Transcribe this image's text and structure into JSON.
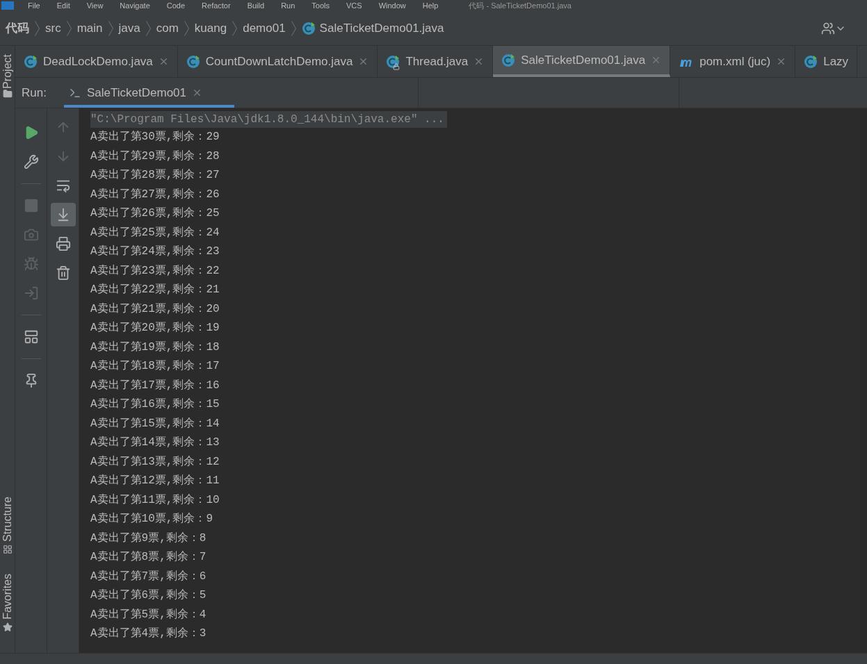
{
  "menu": [
    "File",
    "Edit",
    "View",
    "Navigate",
    "Code",
    "Refactor",
    "Build",
    "Run",
    "Tools",
    "VCS",
    "Window",
    "Help"
  ],
  "window_title": "代码 - SaleTicketDemo01.java",
  "breadcrumb": [
    {
      "label": "代码",
      "kind": "project"
    },
    {
      "label": "src",
      "kind": "folder"
    },
    {
      "label": "main",
      "kind": "folder"
    },
    {
      "label": "java",
      "kind": "folder"
    },
    {
      "label": "com",
      "kind": "folder"
    },
    {
      "label": "kuang",
      "kind": "folder"
    },
    {
      "label": "demo01",
      "kind": "folder"
    },
    {
      "label": "SaleTicketDemo01.java",
      "kind": "class"
    }
  ],
  "editor_tabs": [
    {
      "label": "DeadLockDemo.java",
      "kind": "class",
      "selected": false,
      "locked": false
    },
    {
      "label": "CountDownLatchDemo.java",
      "kind": "class",
      "selected": false,
      "locked": false
    },
    {
      "label": "Thread.java",
      "kind": "class",
      "selected": false,
      "locked": true
    },
    {
      "label": "SaleTicketDemo01.java",
      "kind": "class",
      "selected": true,
      "locked": false
    },
    {
      "label": "pom.xml (juc)",
      "kind": "maven",
      "selected": false,
      "locked": false
    },
    {
      "label": "Lazy",
      "kind": "class",
      "selected": false,
      "locked": false
    }
  ],
  "side_stripe": {
    "top": [
      "Project"
    ],
    "bottom": [
      "Structure",
      "Favorites"
    ]
  },
  "run_panel": {
    "label": "Run:",
    "tabs": [
      {
        "label": "SaleTicketDemo01",
        "selected": true
      }
    ]
  },
  "run_toolbar": [
    {
      "kind": "play",
      "disabled": false
    },
    {
      "kind": "wrench",
      "disabled": false
    },
    {
      "kind": "separator"
    },
    {
      "kind": "stop",
      "disabled": true
    },
    {
      "kind": "camera",
      "disabled": true
    },
    {
      "kind": "bug",
      "disabled": true
    },
    {
      "kind": "login",
      "disabled": true
    },
    {
      "kind": "separator"
    },
    {
      "kind": "layout",
      "disabled": false
    },
    {
      "kind": "separator"
    },
    {
      "kind": "pin",
      "disabled": false
    }
  ],
  "console_toolbar": [
    {
      "kind": "up",
      "disabled": true,
      "selected": false
    },
    {
      "kind": "down",
      "disabled": true,
      "selected": false
    },
    {
      "kind": "wrap",
      "disabled": false,
      "selected": false
    },
    {
      "kind": "scroll-end",
      "disabled": false,
      "selected": true
    },
    {
      "kind": "print",
      "disabled": false,
      "selected": false
    },
    {
      "kind": "trash",
      "disabled": false,
      "selected": false
    }
  ],
  "console": {
    "command": "\"C:\\Program Files\\Java\\jdk1.8.0_144\\bin\\java.exe\" ...",
    "lines": [
      "A卖出了第30票,剩余：29",
      "A卖出了第29票,剩余：28",
      "A卖出了第28票,剩余：27",
      "A卖出了第27票,剩余：26",
      "A卖出了第26票,剩余：25",
      "A卖出了第25票,剩余：24",
      "A卖出了第24票,剩余：23",
      "A卖出了第23票,剩余：22",
      "A卖出了第22票,剩余：21",
      "A卖出了第21票,剩余：20",
      "A卖出了第20票,剩余：19",
      "A卖出了第19票,剩余：18",
      "A卖出了第18票,剩余：17",
      "A卖出了第17票,剩余：16",
      "A卖出了第16票,剩余：15",
      "A卖出了第15票,剩余：14",
      "A卖出了第14票,剩余：13",
      "A卖出了第13票,剩余：12",
      "A卖出了第12票,剩余：11",
      "A卖出了第11票,剩余：10",
      "A卖出了第10票,剩余：9",
      "A卖出了第9票,剩余：8",
      "A卖出了第8票,剩余：7",
      "A卖出了第7票,剩余：6",
      "A卖出了第6票,剩余：5",
      "A卖出了第5票,剩余：4",
      "A卖出了第4票,剩余：3"
    ]
  }
}
